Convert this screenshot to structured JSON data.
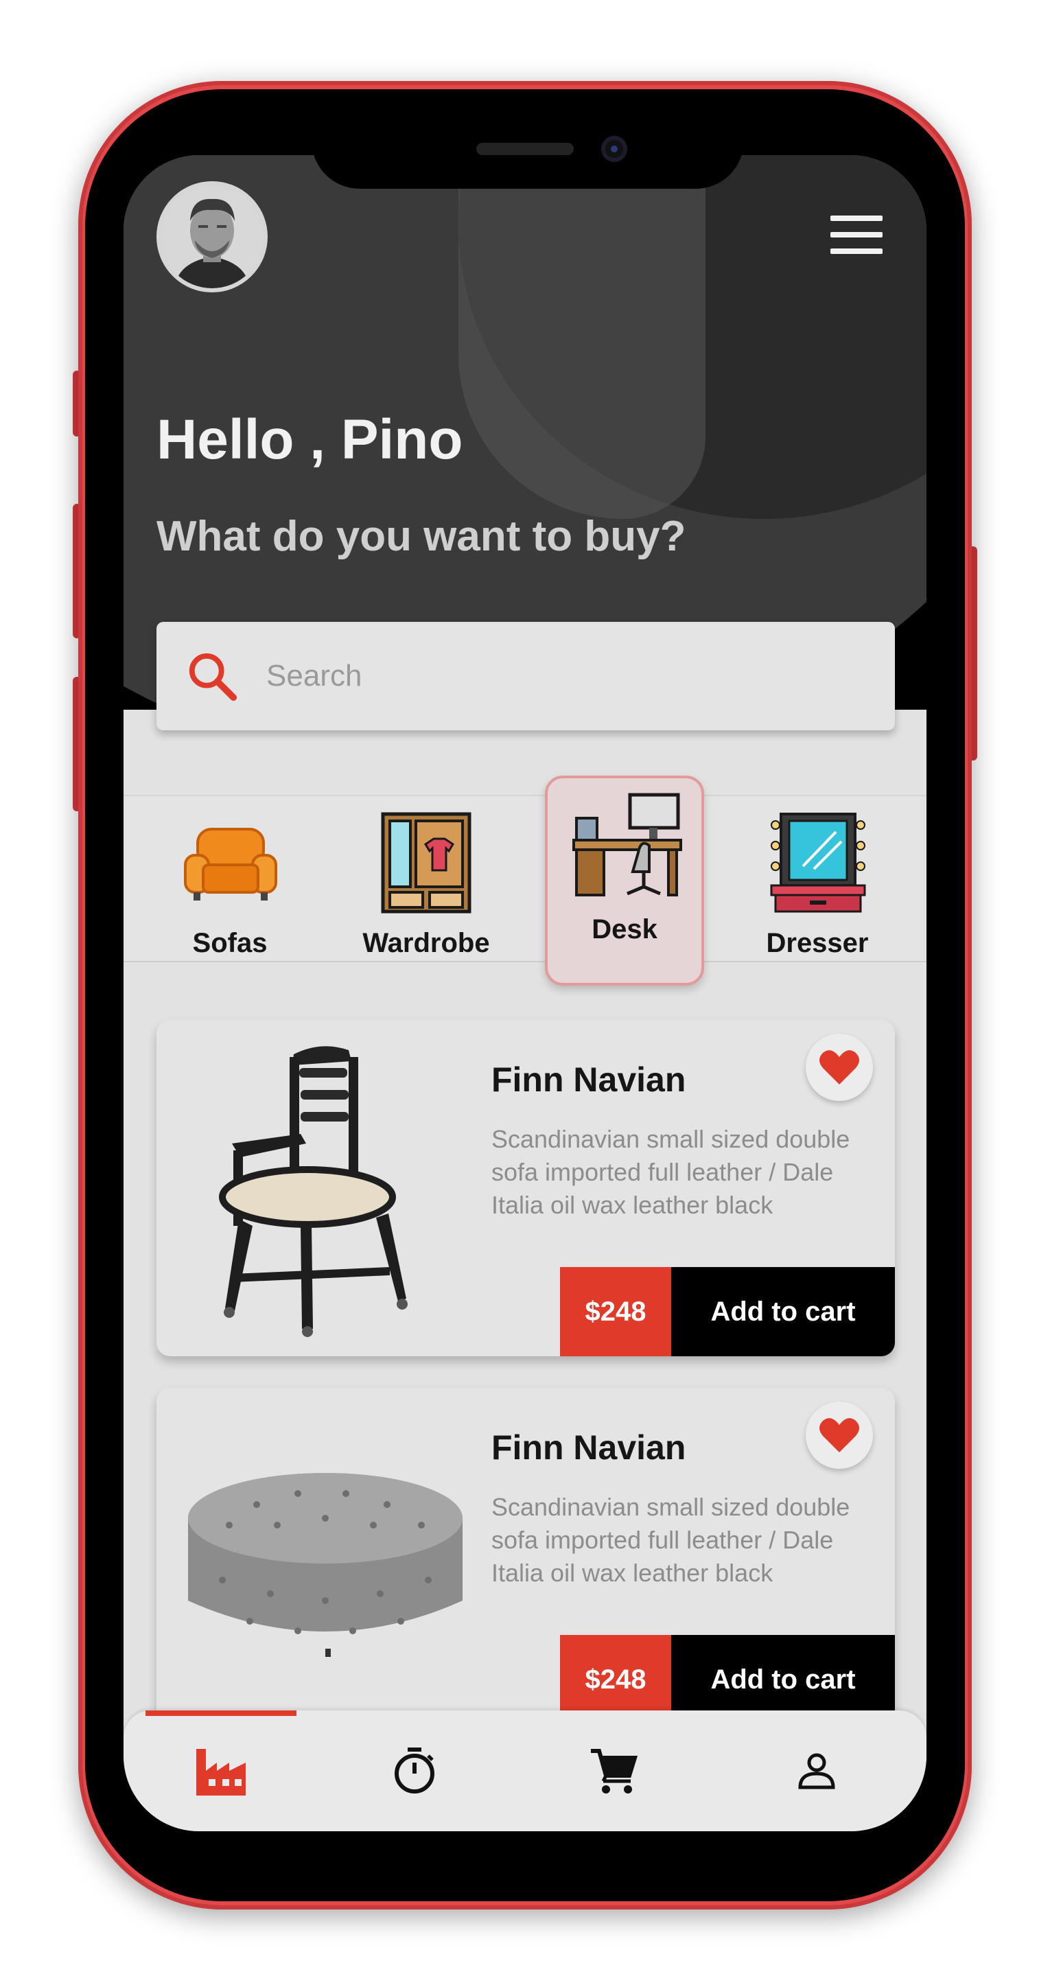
{
  "header": {
    "greeting": "Hello , Pino",
    "subtitle": "What do you want to buy?"
  },
  "search": {
    "placeholder": "Search"
  },
  "categories": [
    {
      "label": "Sofas",
      "icon": "sofa-icon",
      "active": false
    },
    {
      "label": "Wardrobe",
      "icon": "wardrobe-icon",
      "active": false
    },
    {
      "label": "Desk",
      "icon": "desk-icon",
      "active": true
    },
    {
      "label": "Dresser",
      "icon": "dresser-icon",
      "active": false
    }
  ],
  "products": [
    {
      "title": "Finn Navian",
      "description": "Scandinavian small sized double sofa imported full leather / Dale Italia oil wax leather black",
      "price": "$248",
      "cart_label": "Add to cart",
      "image": "chair-image",
      "favorite": true
    },
    {
      "title": "Finn Navian",
      "description": "Scandinavian small sized double sofa imported full leather / Dale Italia oil wax leather black",
      "price": "$248",
      "cart_label": "Add to cart",
      "image": "ottoman-image",
      "favorite": true
    }
  ],
  "nav": [
    {
      "icon": "factory-icon",
      "active": true
    },
    {
      "icon": "timer-icon",
      "active": false
    },
    {
      "icon": "cart-icon",
      "active": false
    },
    {
      "icon": "profile-icon",
      "active": false
    }
  ],
  "colors": {
    "accent": "#e03a2a",
    "phone_frame": "#e2474a",
    "background": "#e2e2e2"
  }
}
